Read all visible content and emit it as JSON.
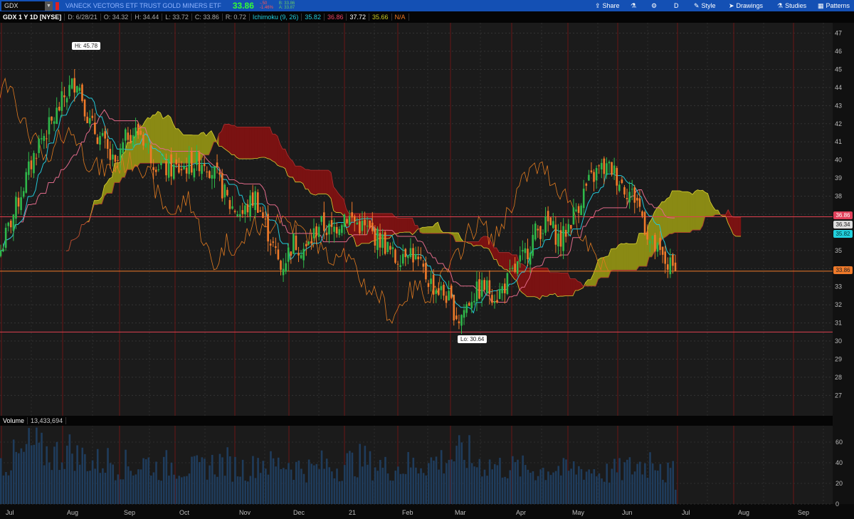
{
  "header": {
    "symbol": "GDX",
    "description": "VANECK VECTORS ETF TRUST GOLD MINERS ETF",
    "last": "33.86",
    "change": "-.50",
    "change_pct": "-1.46%",
    "bid": "B: 33.86",
    "ask": "A: 33.87"
  },
  "toolbar": {
    "share": "Share",
    "timeframe": "D",
    "style": "Style",
    "drawings": "Drawings",
    "studies": "Studies",
    "patterns": "Patterns"
  },
  "info": {
    "title": "GDX 1 Y 1D [NYSE]",
    "date": "D: 6/28/21",
    "open": "O: 34.32",
    "high": "H: 34.44",
    "low": "L: 33.72",
    "close": "C: 33.86",
    "range": "R: 0.72",
    "study": "Ichimoku (9, 26)",
    "v1": "35.82",
    "v2": "36.86",
    "v3": "37.72",
    "v4": "35.66",
    "v5": "N/A"
  },
  "price_tags": {
    "kijun": "36.86",
    "chikou": "36.34",
    "tenkan": "35.82",
    "last": "33.86"
  },
  "callouts": {
    "hi": "Hi: 45.78",
    "lo": "Lo: 30.64"
  },
  "volume": {
    "label": "Volume",
    "value": "13,433,694"
  },
  "colors": {
    "up": "#2fb84a",
    "down": "#f07a2a",
    "tenkan": "#22c8d8",
    "kijun": "#e06a8a",
    "chikou": "#e07a20",
    "bull_cloud": "#8a8a14",
    "bear_cloud": "#7a1212",
    "volume": "#1f3c5c"
  },
  "chart_data": {
    "type": "candlestick",
    "title": "GDX 1 Y 1D",
    "y_ticks": [
      "47",
      "46",
      "45",
      "44",
      "43",
      "42",
      "41",
      "40",
      "39",
      "38",
      "37",
      "36",
      "35",
      "34",
      "33",
      "32",
      "31",
      "30",
      "29",
      "28",
      "27"
    ],
    "ylim": [
      26.5,
      47.6
    ],
    "x_ticks": [
      "Jul",
      "Aug",
      "Sep",
      "Oct",
      "Nov",
      "Dec",
      "21",
      "Feb",
      "Mar",
      "Apr",
      "May",
      "Jun",
      "Jul",
      "Aug",
      "Sep"
    ],
    "weekly_close": [
      35,
      37,
      39,
      41,
      42,
      43.5,
      44.5,
      42,
      41,
      39.5,
      41.5,
      41.5,
      40,
      39.5,
      39.5,
      39.8,
      40,
      39,
      37.5,
      37,
      38,
      36,
      34,
      35.5,
      35,
      36.5,
      36,
      37,
      36.5,
      36,
      35.5,
      34.5,
      35.2,
      34,
      33,
      32.5,
      31.2,
      32.5,
      33,
      32.5,
      33.5,
      34.5,
      36,
      36.5,
      35.5,
      37,
      38.5,
      39.5,
      39.5,
      38.5,
      37.8,
      35.5,
      34.5,
      33.86
    ],
    "volume_ticks": [
      "60",
      "40",
      "20",
      "0"
    ],
    "weekly_volume_millions": [
      40,
      45,
      55,
      50,
      48,
      52,
      45,
      40,
      42,
      38,
      36,
      40,
      35,
      38,
      36,
      34,
      38,
      40,
      36,
      35,
      42,
      38,
      40,
      36,
      34,
      38,
      36,
      40,
      42,
      38,
      35,
      36,
      38,
      40,
      42,
      45,
      48,
      40,
      38,
      36,
      35,
      34,
      33,
      35,
      32,
      34,
      33,
      30,
      32,
      35,
      38,
      45,
      30,
      13.4
    ],
    "horizontal_lines": [
      36.86,
      33.86,
      30.5
    ]
  }
}
